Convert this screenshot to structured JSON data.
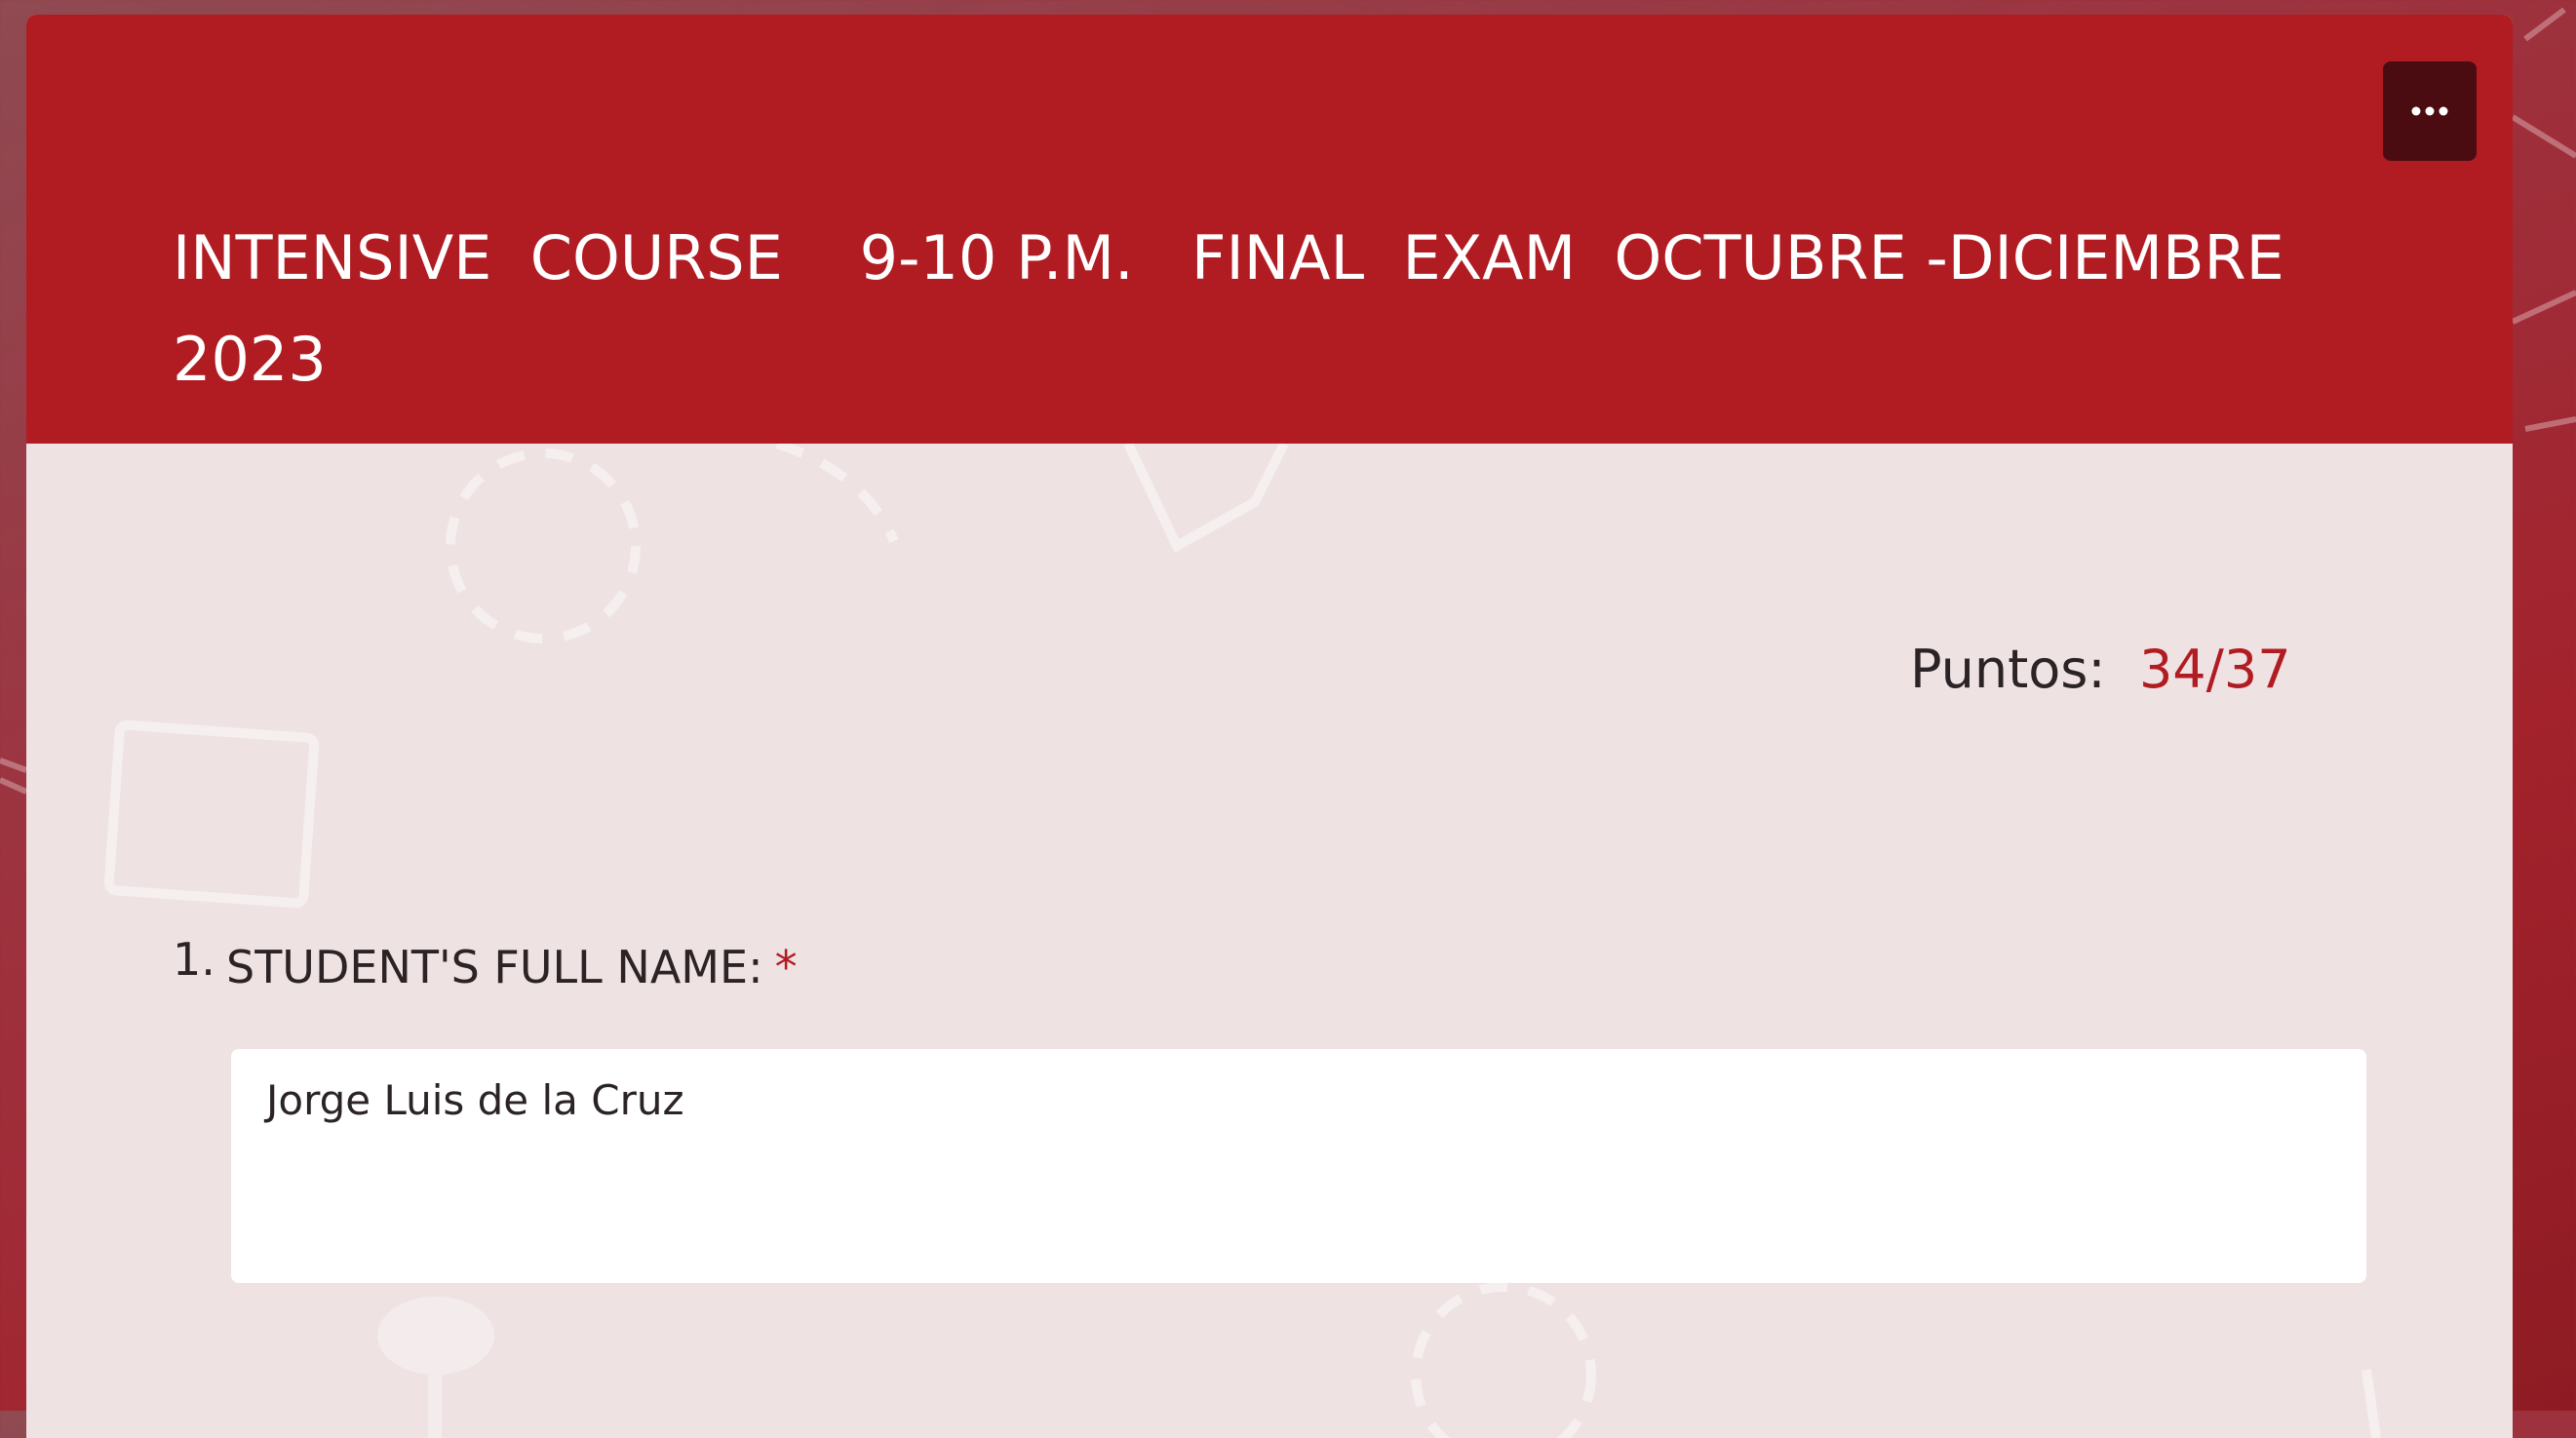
{
  "header": {
    "title": "INTENSIVE  COURSE    9-10 P.M.   FINAL  EXAM  OCTUBRE -DICIEMBRE 2023",
    "more_icon": "ellipsis-icon"
  },
  "score": {
    "label": "Puntos:",
    "value": "34/37"
  },
  "questions": [
    {
      "number": "1.",
      "label": "STUDENT'S FULL NAME:",
      "required_mark": "*",
      "answer": "Jorge Luis de la Cruz"
    }
  ],
  "colors": {
    "header_background": "#b01c22",
    "accent": "#b01c22",
    "menu_button": "#4a0c10",
    "card_background": "#efe2e3"
  }
}
